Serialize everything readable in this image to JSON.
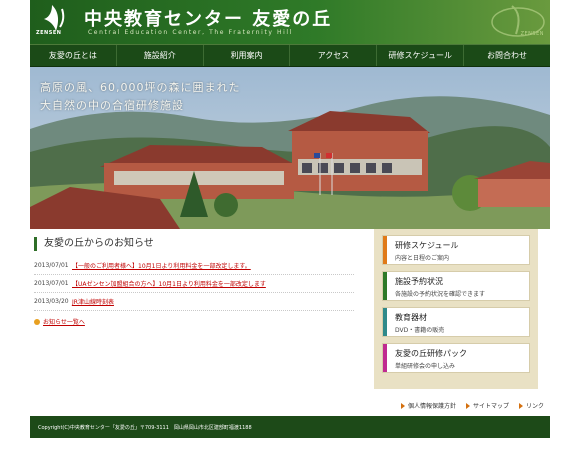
{
  "header": {
    "logo_text": "ZENSEN",
    "title": "中央教育センター 友愛の丘",
    "subtitle": "Central Education Center, The Fraternity Hill",
    "deco_text": "ZENSEN"
  },
  "nav": [
    {
      "label": "友愛の丘とは"
    },
    {
      "label": "施設紹介"
    },
    {
      "label": "利用案内"
    },
    {
      "label": "アクセス"
    },
    {
      "label": "研修スケジュール"
    },
    {
      "label": "お問合わせ"
    }
  ],
  "hero": {
    "line1": "高原の風、60,000坪の森に囲まれた",
    "line2": "大自然の中の合宿研修施設"
  },
  "news": {
    "title": "友愛の丘からのお知らせ",
    "items": [
      {
        "date": "2013/07/01",
        "text": "【一般のご利用者様へ】10月1日より利用料金を一部改定します。"
      },
      {
        "date": "2013/07/01",
        "text": "【UAゼンセン加盟組合の方へ】10月1日より利用料金を一部改定します"
      },
      {
        "date": "2013/03/20",
        "text": "JR津山線時刻表"
      }
    ],
    "more": "お知らせ一覧へ"
  },
  "side": [
    {
      "title": "研修スケジュール",
      "sub": "内容と日程のご案内",
      "color": "#e07a18"
    },
    {
      "title": "施設予約状況",
      "sub": "各施設の予約状況を確認できます",
      "color": "#2e7a28"
    },
    {
      "title": "教育器材",
      "sub": "DVD・書籍の販売",
      "color": "#2f8a8a"
    },
    {
      "title": "友愛の丘研修パック",
      "sub": "単組研修会の申し込み",
      "color": "#c02a90"
    }
  ],
  "footer_links": [
    "個人情報保護方針",
    "サイトマップ",
    "リンク"
  ],
  "copyright": "Copyright(C)中央教育センター「友愛の丘」〒709-3111　岡山県岡山市北区建部町福渡1188",
  "colors": {
    "brand_green": "#1f5e1c",
    "accent_orange": "#e07a18",
    "link_red": "#c00000"
  }
}
